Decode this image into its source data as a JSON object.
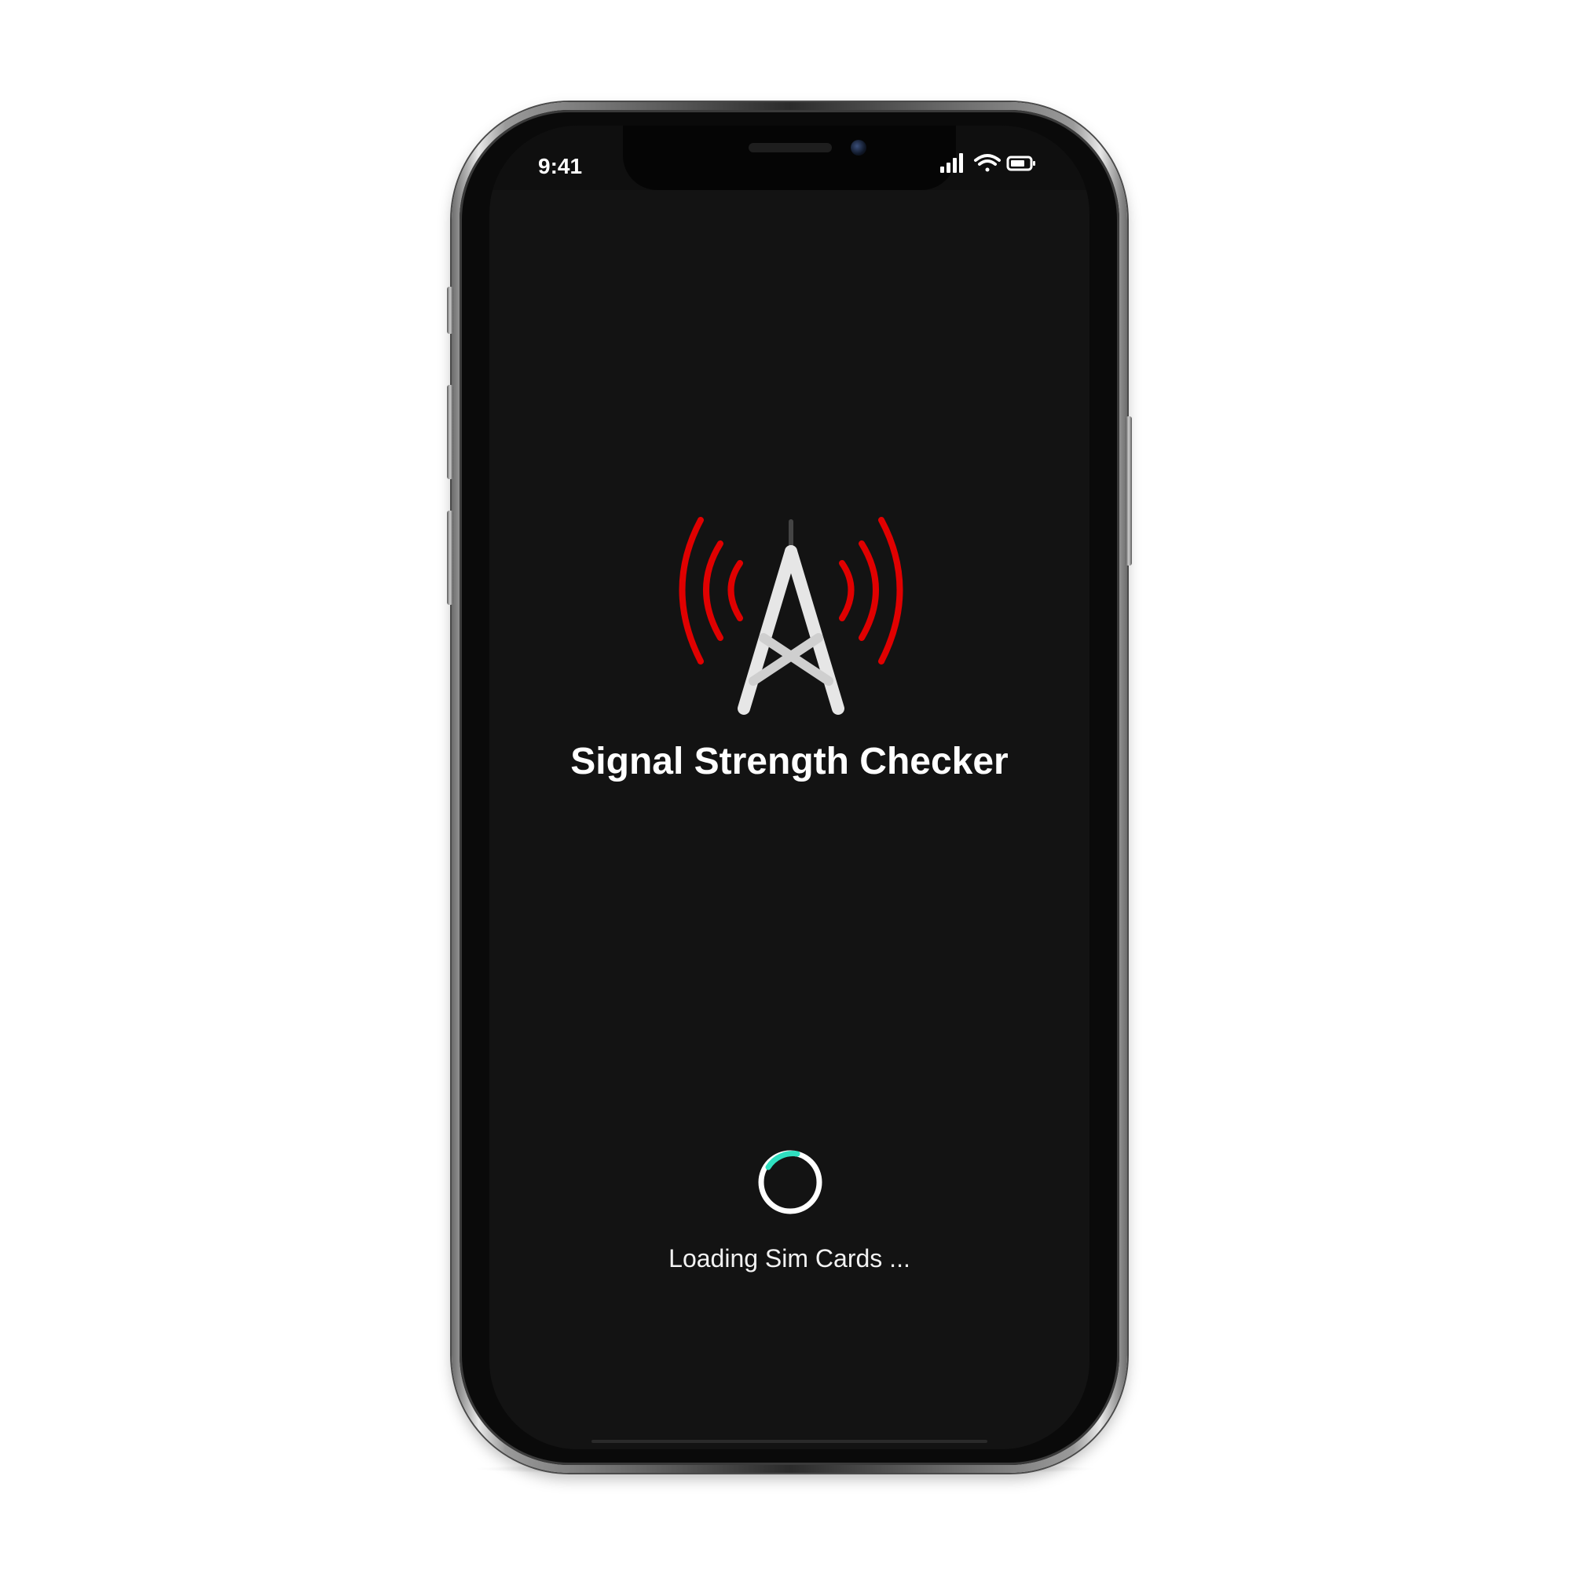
{
  "status_bar": {
    "time": "9:41",
    "icons": [
      "cellular-signal-icon",
      "wifi-icon",
      "battery-icon"
    ]
  },
  "app": {
    "title": "Signal Strength Checker",
    "logo_icon": "cell-tower-icon"
  },
  "loading": {
    "spinner_icon": "loading-spinner-icon",
    "message": "Loading Sim Cards ..."
  },
  "colors": {
    "screen_background": "#131313",
    "signal_waves": "#e00000",
    "tower": "#e6e6e6",
    "spinner_accent": "#2fe0c0",
    "text": "#ffffff"
  }
}
